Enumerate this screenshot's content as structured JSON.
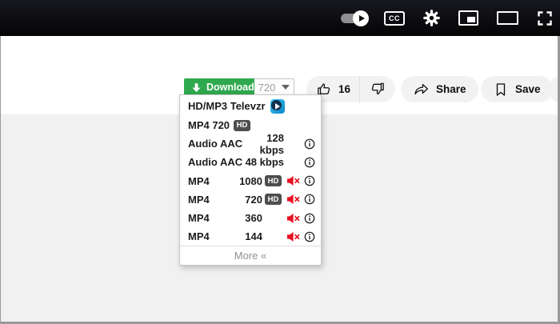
{
  "player_bar": {
    "cc_label": "CC",
    "icons": [
      "autoplay-toggle",
      "closed-captions",
      "settings-gear",
      "miniplayer",
      "theater-mode",
      "fullscreen"
    ]
  },
  "actions": {
    "download": {
      "label": "Download",
      "quality": "720"
    },
    "like_count": "16",
    "share_label": "Share",
    "save_label": "Save"
  },
  "menu": {
    "header": {
      "label": "HD/MP3 Televzr",
      "logo": "televzr-play-logo"
    },
    "rows": [
      {
        "label": "MP4 720",
        "hd": "HD"
      },
      {
        "label": "Audio AAC",
        "value": "128 kbps",
        "info": true
      },
      {
        "label": "Audio AAC",
        "value": "48 kbps",
        "info": true
      },
      {
        "label": "MP4",
        "value": "1080",
        "hd": "HD",
        "muted": true,
        "info": true
      },
      {
        "label": "MP4",
        "value": "720",
        "hd": "HD",
        "muted": true,
        "info": true
      },
      {
        "label": "MP4",
        "value": "360",
        "muted": true,
        "info": true
      },
      {
        "label": "MP4",
        "value": "144",
        "muted": true,
        "info": true
      }
    ],
    "footer": "More «"
  },
  "colors": {
    "download_green": "#2fa94d",
    "pill_gray": "#f2f2f2",
    "page_gray": "#f1f1f1",
    "player_bar_black": "#0a0a0d",
    "muted_red": "#e81123",
    "hd_badge_gray": "#4d4d4d",
    "border_gray": "#9a9a9a"
  }
}
